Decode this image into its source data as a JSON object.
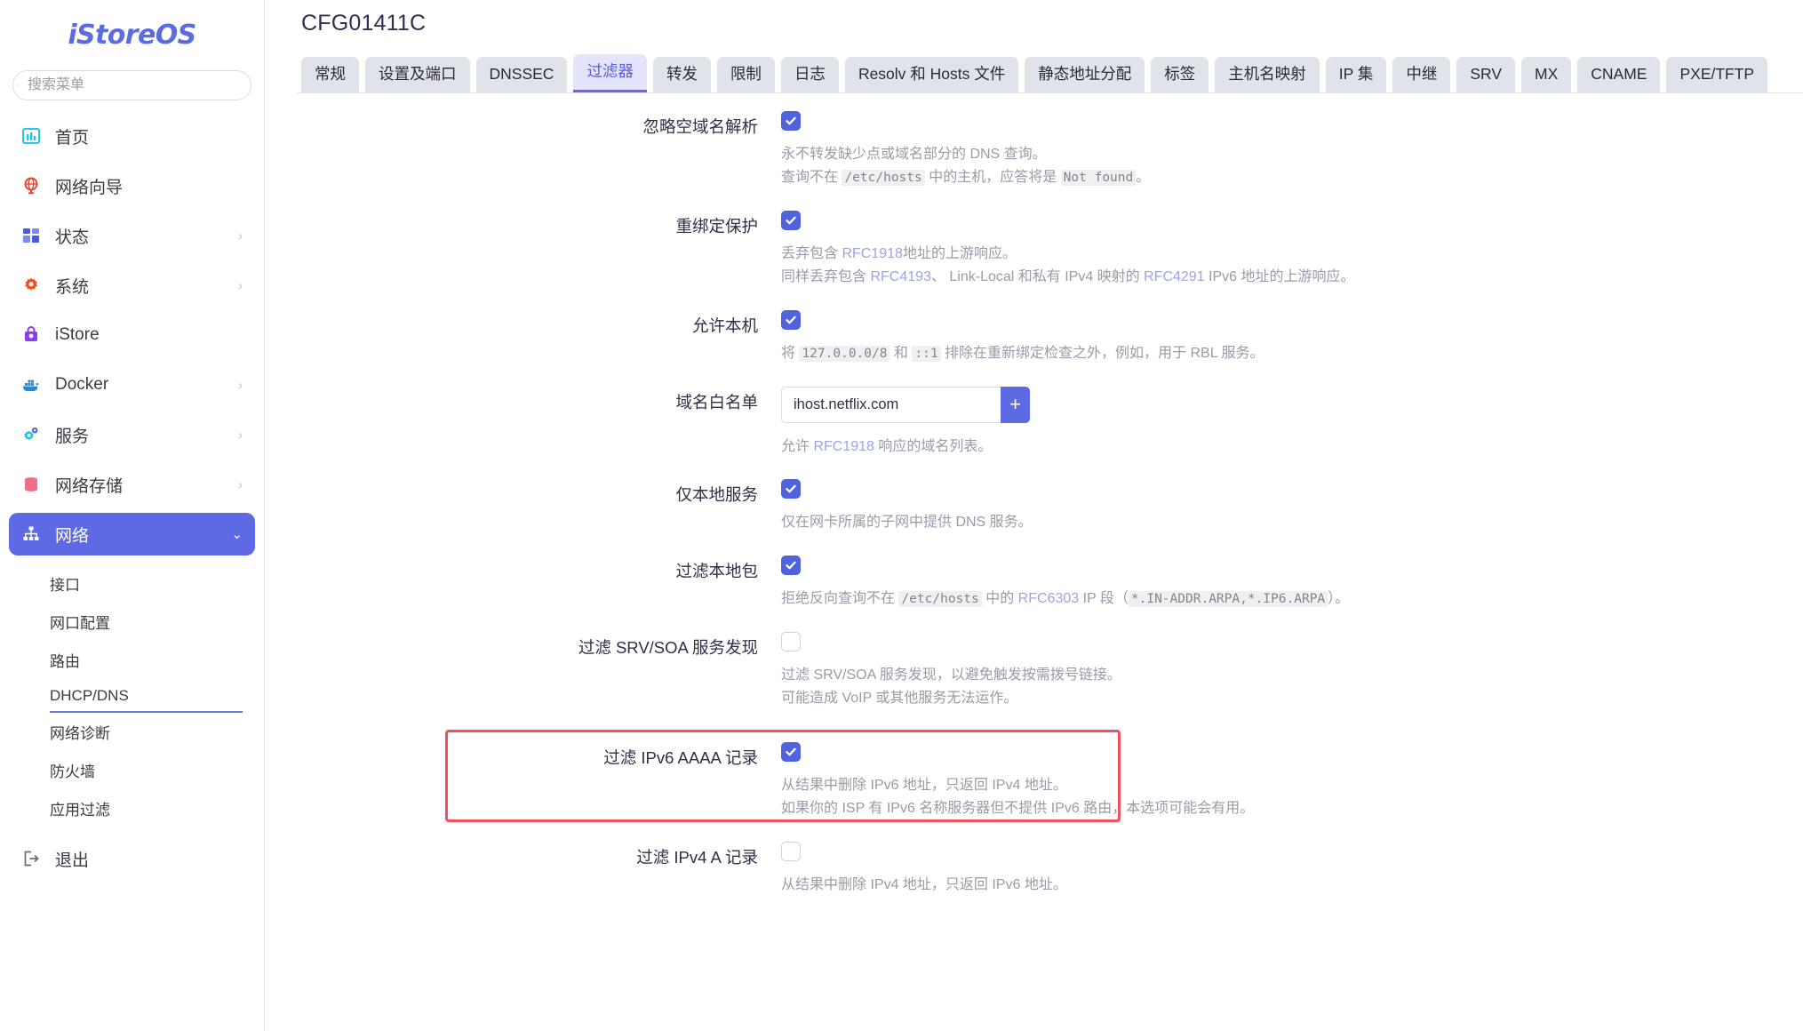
{
  "sidebar": {
    "brand": "iStoreOS",
    "search_placeholder": "搜索菜单",
    "items": [
      {
        "label": "首页",
        "icon": "home-chart-icon",
        "arrow": ""
      },
      {
        "label": "网络向导",
        "icon": "globe-icon",
        "arrow": ""
      },
      {
        "label": "状态",
        "icon": "grid-icon",
        "arrow": "›"
      },
      {
        "label": "系统",
        "icon": "gear-icon",
        "arrow": "›"
      },
      {
        "label": "iStore",
        "icon": "bag-icon",
        "arrow": ""
      },
      {
        "label": "Docker",
        "icon": "docker-icon",
        "arrow": "›"
      },
      {
        "label": "服务",
        "icon": "gears-icon",
        "arrow": "›"
      },
      {
        "label": "网络存储",
        "icon": "database-icon",
        "arrow": "›"
      },
      {
        "label": "网络",
        "icon": "sitemap-icon",
        "arrow": "⌄",
        "active": true
      }
    ],
    "subitems": [
      {
        "label": "接口"
      },
      {
        "label": "网口配置"
      },
      {
        "label": "路由"
      },
      {
        "label": "DHCP/DNS",
        "active": true
      },
      {
        "label": "网络诊断"
      },
      {
        "label": "防火墙"
      },
      {
        "label": "应用过滤"
      }
    ],
    "logout": {
      "label": "退出",
      "icon": "logout-icon"
    }
  },
  "header": {
    "title": "CFG01411C"
  },
  "tabs": [
    {
      "label": "常规"
    },
    {
      "label": "设置及端口"
    },
    {
      "label": "DNSSEC"
    },
    {
      "label": "过滤器",
      "active": true
    },
    {
      "label": "转发"
    },
    {
      "label": "限制"
    },
    {
      "label": "日志"
    },
    {
      "label": "Resolv 和 Hosts 文件"
    },
    {
      "label": "静态地址分配"
    },
    {
      "label": "标签"
    },
    {
      "label": "主机名映射"
    },
    {
      "label": "IP 集"
    },
    {
      "label": "中继"
    },
    {
      "label": "SRV"
    },
    {
      "label": "MX"
    },
    {
      "label": "CNAME"
    },
    {
      "label": "PXE/TFTP"
    }
  ],
  "form": {
    "ignore_empty": {
      "label": "忽略空域名解析",
      "checked": true,
      "desc_l1": "永不转发缺少点或域名部分的 DNS 查询。",
      "desc_l2_a": "查询不在 ",
      "desc_l2_code1": "/etc/hosts",
      "desc_l2_b": " 中的主机，应答将是 ",
      "desc_l2_code2": "Not found",
      "desc_l2_c": "。"
    },
    "rebind": {
      "label": "重绑定保护",
      "checked": true,
      "desc_l1_a": "丢弃包含 ",
      "desc_l1_lnk": "RFC1918",
      "desc_l1_b": "地址的上游响应。",
      "desc_l2_a": "同样丢弃包含 ",
      "desc_l2_lnk1": "RFC4193",
      "desc_l2_b": "、 Link-Local 和私有 IPv4 映射的 ",
      "desc_l2_lnk2": "RFC4291",
      "desc_l2_c": " IPv6 地址的上游响应。"
    },
    "allow_localhost": {
      "label": "允许本机",
      "checked": true,
      "desc_a": "将 ",
      "desc_code1": "127.0.0.0/8",
      "desc_b": " 和 ",
      "desc_code2": "::1",
      "desc_c": " 排除在重新绑定检查之外，例如，用于 RBL 服务。"
    },
    "whitelist": {
      "label": "域名白名单",
      "value": "ihost.netflix.com",
      "add_label": "+",
      "desc_a": "允许 ",
      "desc_lnk": "RFC1918",
      "desc_b": " 响应的域名列表。"
    },
    "local_service_only": {
      "label": "仅本地服务",
      "checked": true,
      "desc": "仅在网卡所属的子网中提供 DNS 服务。"
    },
    "filter_local_pkts": {
      "label": "过滤本地包",
      "checked": true,
      "desc_a": "拒绝反向查询不在 ",
      "desc_code1": "/etc/hosts",
      "desc_b": " 中的 ",
      "desc_lnk": "RFC6303",
      "desc_c": " IP 段（",
      "desc_code2": "*.IN-ADDR.ARPA,*.IP6.ARPA",
      "desc_d": "）。"
    },
    "filter_srv_soa": {
      "label": "过滤 SRV/SOA 服务发现",
      "checked": false,
      "desc_l1": "过滤 SRV/SOA 服务发现，以避免触发按需拨号链接。",
      "desc_l2": "可能造成 VoIP 或其他服务无法运作。"
    },
    "filter_ipv6_aaaa": {
      "label": "过滤 IPv6 AAAA 记录",
      "checked": true,
      "desc_l1": "从结果中删除 IPv6 地址，只返回 IPv4 地址。",
      "desc_l2": "如果你的 ISP 有 IPv6 名称服务器但不提供 IPv6 路由，本选项可能会有用。",
      "highlighted": true
    },
    "filter_ipv4_a": {
      "label": "过滤 IPv4 A 记录",
      "checked": false,
      "desc_l1": "从结果中删除 IPv4 地址，只返回 IPv6 地址。"
    }
  },
  "colors": {
    "accent": "#5d6ae4",
    "tab_active_bg": "#e5e4ff",
    "tab_active_text": "#5b5bd6",
    "highlight_border": "#f4505c",
    "link": "#9aa4e8"
  }
}
